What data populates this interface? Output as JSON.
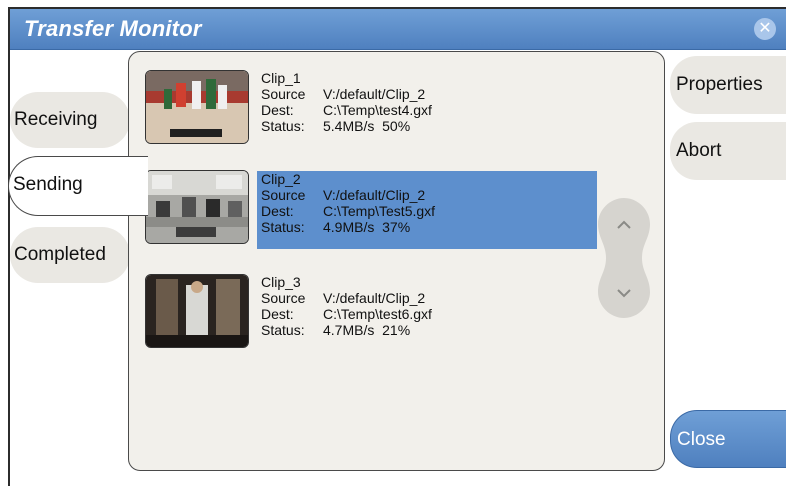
{
  "window": {
    "title": "Transfer Monitor"
  },
  "tabs": [
    {
      "label": "Receiving"
    },
    {
      "label": "Sending"
    },
    {
      "label": "Completed"
    }
  ],
  "labels": {
    "source": "Source",
    "dest": "Dest:",
    "status": "Status:"
  },
  "clips": [
    {
      "name": "Clip_1",
      "source": "V:/default/Clip_2",
      "dest": "C:\\Temp\\test4.gxf",
      "status": "5.4MB/s  50%",
      "thumbnail": "basketball-game"
    },
    {
      "name": "Clip_2",
      "source": "V:/default/Clip_2",
      "dest": "C:\\Temp\\Test5.gxf",
      "status": "4.9MB/s  37%",
      "thumbnail": "meeting-room",
      "selected": true
    },
    {
      "name": "Clip_3",
      "source": "V:/default/Clip_2",
      "dest": "C:\\Temp\\test6.gxf",
      "status": "4.7MB/s  21%",
      "thumbnail": "man-at-window"
    }
  ],
  "actions": {
    "properties": "Properties",
    "abort": "Abort",
    "close": "Close"
  },
  "colors": {
    "titlebar": "#5b8dcc",
    "selection": "#5d8fcd",
    "panel": "#f2f0eb",
    "tab": "#eae8e3"
  }
}
